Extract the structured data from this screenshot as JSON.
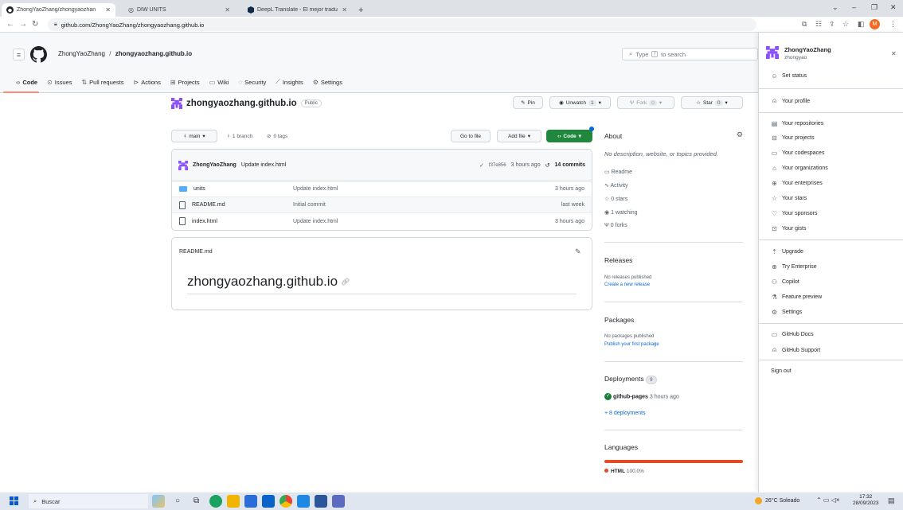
{
  "browser": {
    "tabs": [
      {
        "label": "ZhongYaoZhang/zhongyaozhan",
        "active": true
      },
      {
        "label": "DIW UNITS",
        "active": false
      },
      {
        "label": "DeepL Translate - El mejor tradu",
        "active": false
      }
    ],
    "new_tab": "+",
    "url": "github.com/ZhongYaoZhang/zhongyaozhang.github.io",
    "avatar_letter": "M"
  },
  "header": {
    "owner": "ZhongYaoZhang",
    "separator": "/",
    "repo": "zhongyaozhang.github.io",
    "search_before": "Type",
    "search_key": "/",
    "search_after": "to search"
  },
  "repo_nav": [
    {
      "label": "Code",
      "icon": "code-icon"
    },
    {
      "label": "Issues",
      "icon": "issue-icon"
    },
    {
      "label": "Pull requests",
      "icon": "pull-request-icon"
    },
    {
      "label": "Actions",
      "icon": "play-icon"
    },
    {
      "label": "Projects",
      "icon": "table-icon"
    },
    {
      "label": "Wiki",
      "icon": "book-icon"
    },
    {
      "label": "Security",
      "icon": "shield-icon"
    },
    {
      "label": "Insights",
      "icon": "graph-icon"
    },
    {
      "label": "Settings",
      "icon": "gear-icon"
    }
  ],
  "repo": {
    "name": "zhongyaozhang.github.io",
    "visibility": "Public",
    "pin": "Pin",
    "unwatch": "Unwatch",
    "watch_count": "1",
    "fork": "Fork",
    "fork_count": "0",
    "star": "Star",
    "star_count": "0",
    "branch": "main",
    "branches": "1 branch",
    "tags": "0 tags",
    "go_to_file": "Go to file",
    "add_file": "Add file",
    "code": "Code"
  },
  "commit": {
    "author": "ZhongYaoZhang",
    "message": "Update index.html",
    "hash": "f37e856",
    "time": "3 hours ago",
    "count": "14 commits"
  },
  "files": [
    {
      "name": "units",
      "type": "folder",
      "message": "Update index.html",
      "time": "3 hours ago"
    },
    {
      "name": "README.md",
      "type": "file",
      "message": "Initial commit",
      "time": "last week"
    },
    {
      "name": "index.html",
      "type": "file",
      "message": "Update index.html",
      "time": "3 hours ago"
    }
  ],
  "readme": {
    "label": "README.md",
    "heading": "zhongyaozhang.github.io"
  },
  "about": {
    "title": "About",
    "description": "No description, website, or topics provided.",
    "readme": "Readme",
    "activity": "Activity",
    "stars": "0 stars",
    "watching": "1 watching",
    "forks": "0 forks",
    "releases_title": "Releases",
    "releases_none": "No releases published",
    "releases_link": "Create a new release",
    "packages_title": "Packages",
    "packages_none": "No packages published",
    "packages_link": "Publish your first package",
    "deployments_title": "Deployments",
    "deployments_count": "9",
    "deploy_env": "github-pages",
    "deploy_time": "3 hours ago",
    "deploy_more": "+ 8 deployments",
    "languages_title": "Languages",
    "lang_name": "HTML",
    "lang_pct": "100.0%",
    "lang_fraction": 1.0,
    "lang_color": "#e34c26"
  },
  "profile": {
    "display_name": "ZhongYaoZhang",
    "username": "zhongyao",
    "set_status": "Set status",
    "items_a": [
      "Your profile"
    ],
    "items_b": [
      "Your repositories",
      "Your projects",
      "Your codespaces",
      "Your organizations",
      "Your enterprises",
      "Your stars",
      "Your sponsors",
      "Your gists"
    ],
    "items_c": [
      "Upgrade",
      "Try Enterprise",
      "Copilot",
      "Feature preview",
      "Settings"
    ],
    "items_d": [
      "GitHub Docs",
      "GitHub Support"
    ],
    "sign_out": "Sign out"
  },
  "taskbar": {
    "search": "Buscar",
    "weather": "26°C Soleado",
    "time": "17:32",
    "date": "28/09/2023"
  },
  "colors": {
    "accent_green": "#1f883d",
    "link_blue": "#0969da",
    "tab_underline": "#fd8c73",
    "avatar_purple": "#8a4fff",
    "folder_blue": "#54aeff"
  }
}
